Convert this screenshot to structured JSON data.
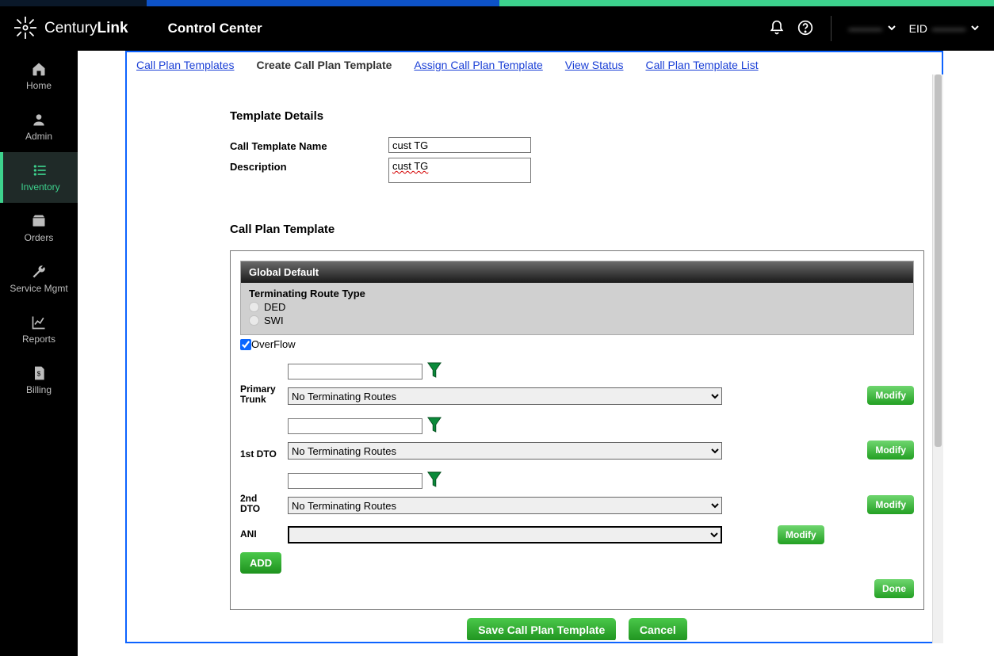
{
  "header": {
    "brand_a": "Century",
    "brand_b": "Link",
    "app_title": "Control Center",
    "user_label": "———",
    "eid_prefix": "EID",
    "eid_value": "———"
  },
  "sidebar": {
    "items": [
      {
        "label": "Home"
      },
      {
        "label": "Admin"
      },
      {
        "label": "Inventory"
      },
      {
        "label": "Orders"
      },
      {
        "label": "Service Mgmt"
      },
      {
        "label": "Reports"
      },
      {
        "label": "Billing"
      }
    ]
  },
  "subnav": {
    "a": "Call Plan Templates",
    "b": "Create Call Plan Template",
    "c": "Assign Call Plan Template",
    "d": "View Status",
    "e": "Call Plan Template List"
  },
  "form": {
    "template_details_h": "Template Details",
    "name_label": "Call Template Name",
    "name_value": "cust TG",
    "desc_label": "Description",
    "desc_value": "cust TG",
    "cpt_h": "Call Plan Template",
    "global_default_h": "Global Default",
    "term_route_h": "Terminating Route Type",
    "radio1": "DED",
    "radio2": "SWI",
    "overflow_label": "OverFlow",
    "routes": {
      "primary_label": "Primary Trunk",
      "first_dto_label": "1st DTO",
      "second_dto_label": "2nd DTO",
      "no_term": "No Terminating Routes",
      "modify": "Modify"
    },
    "ani_label": "ANI",
    "add_label": "ADD",
    "done_label": "Done",
    "save_label": "Save Call Plan Template",
    "cancel_label": "Cancel"
  }
}
